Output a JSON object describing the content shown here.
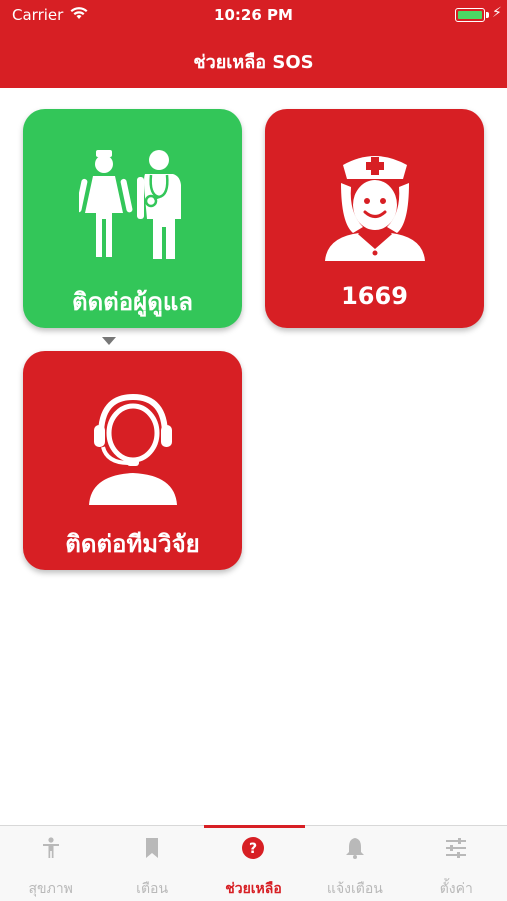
{
  "status_bar": {
    "carrier": "Carrier",
    "time": "10:26 PM"
  },
  "header": {
    "title": "ช่วยเหลือ SOS"
  },
  "tiles": [
    {
      "label": "ติดต่อผู้ดูแล",
      "color": "#33c659",
      "icon": "caregivers-icon"
    },
    {
      "label": "1669",
      "color": "#d71f24",
      "icon": "nurse-icon"
    },
    {
      "label": "ติดต่อทีมวิจัย",
      "color": "#d71f24",
      "icon": "headset-operator-icon"
    }
  ],
  "tabbar": {
    "active_index": 2,
    "items": [
      {
        "label": "สุขภาพ",
        "icon": "person-icon"
      },
      {
        "label": "เตือน",
        "icon": "bookmark-icon"
      },
      {
        "label": "ช่วยเหลือ",
        "icon": "help-icon"
      },
      {
        "label": "แจ้งเตือน",
        "icon": "bell-icon"
      },
      {
        "label": "ตั้งค่า",
        "icon": "sliders-icon"
      }
    ]
  },
  "colors": {
    "brand_red": "#d71f24",
    "green": "#33c659",
    "inactive_tab": "#b9b9b9"
  }
}
